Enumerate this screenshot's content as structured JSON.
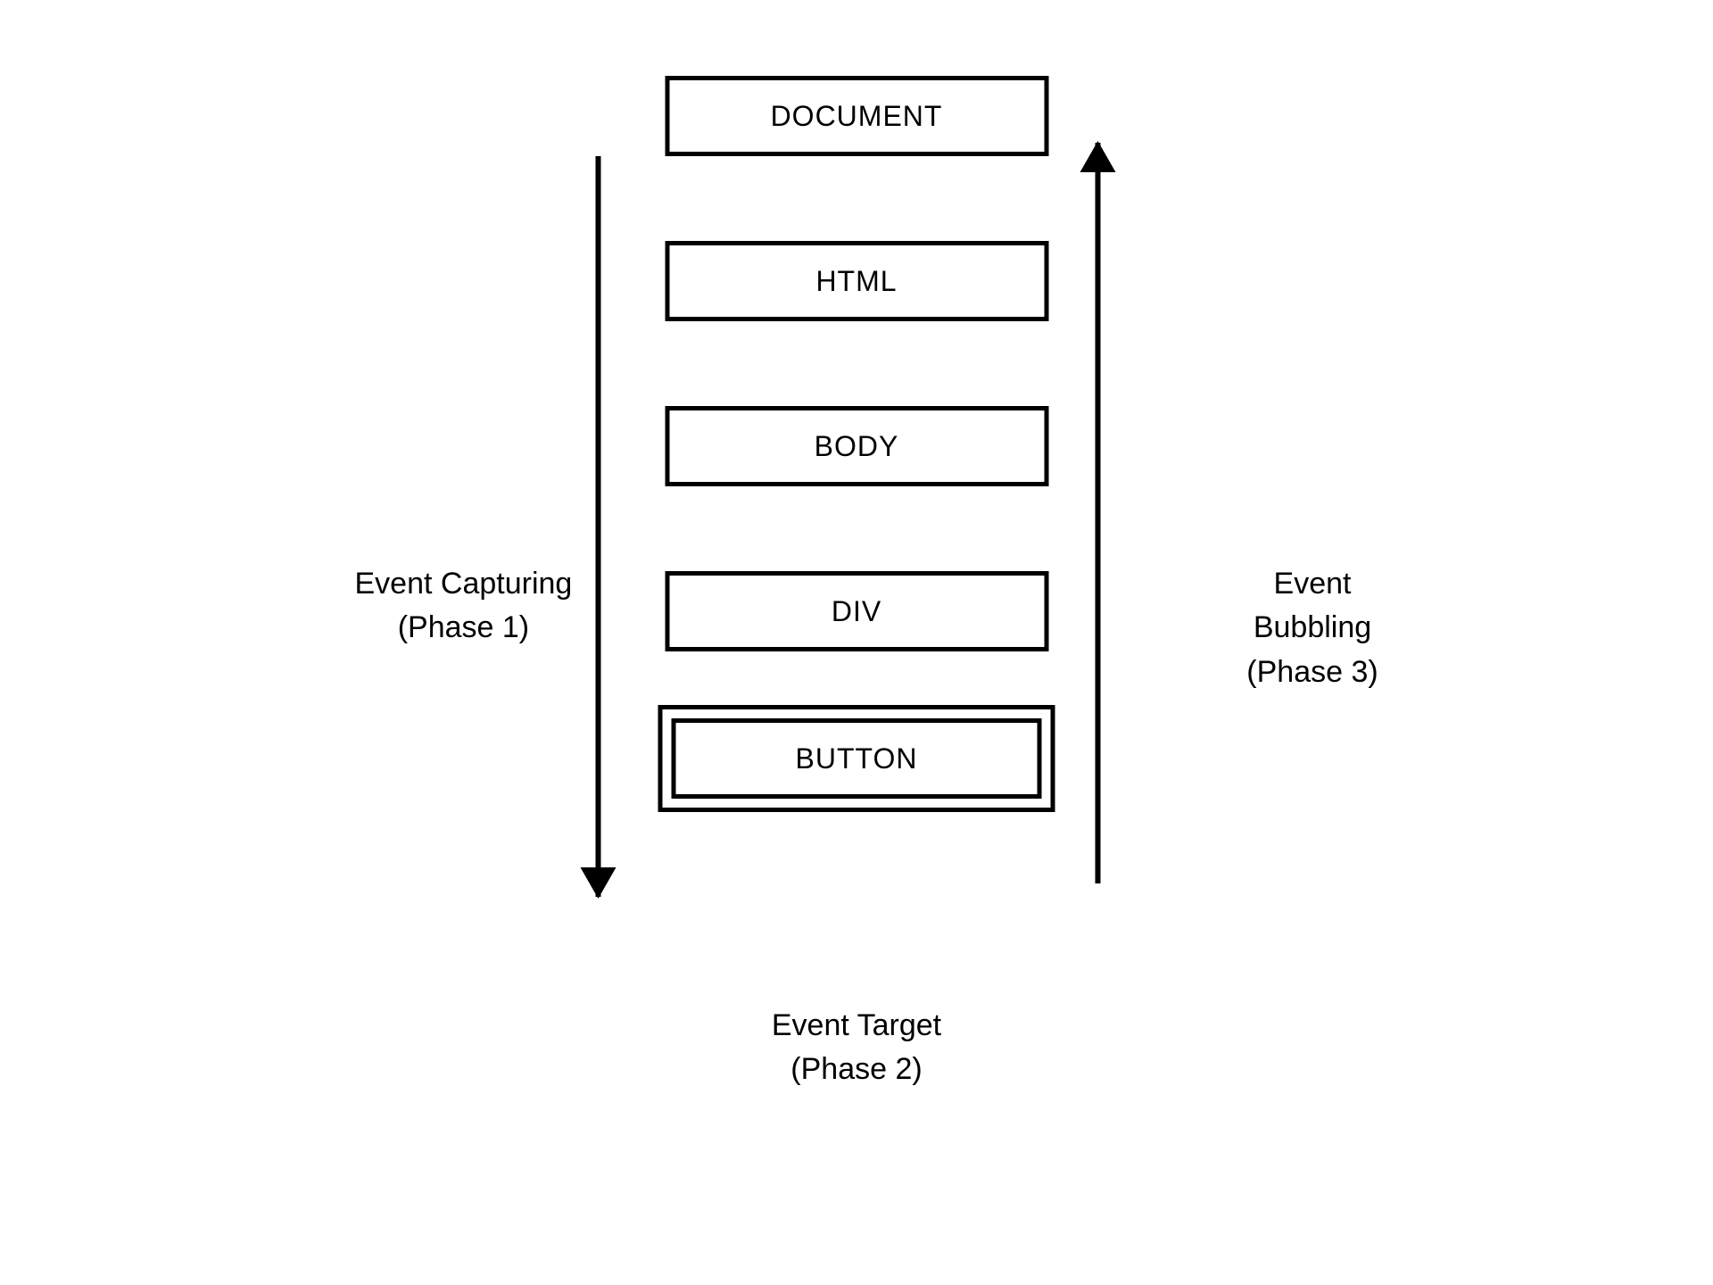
{
  "nodes": {
    "document": "DOCUMENT",
    "html": "HTML",
    "body": "BODY",
    "div": "DIV",
    "button": "BUTTON"
  },
  "labels": {
    "capturing_title": "Event Capturing",
    "capturing_phase": "(Phase 1)",
    "bubbling_title": "Event Bubbling",
    "bubbling_phase": "(Phase 3)",
    "target_title": "Event Target",
    "target_phase": "(Phase 2)"
  }
}
